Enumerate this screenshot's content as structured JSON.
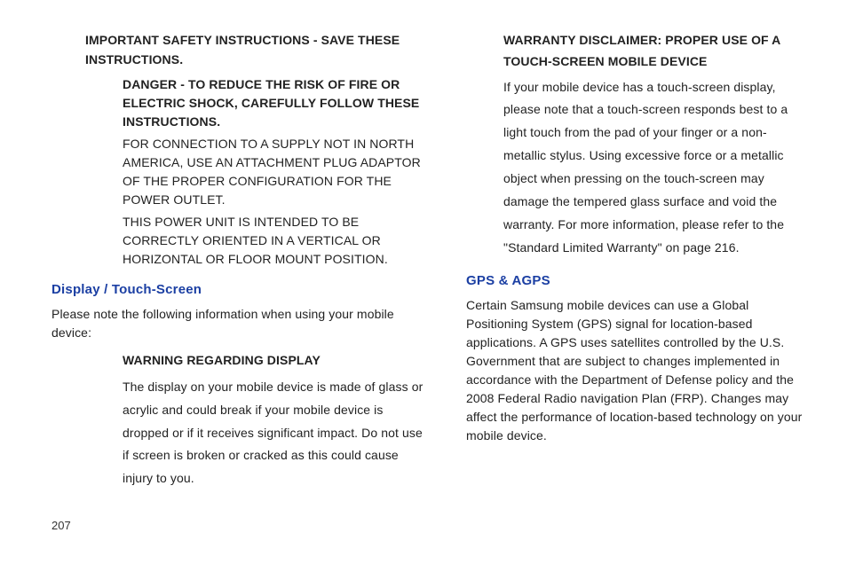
{
  "page_number": "207",
  "left": {
    "safety_heading": "IMPORTANT SAFETY INSTRUCTIONS - SAVE THESE INSTRUCTIONS.",
    "danger_bold": "DANGER - TO REDUCE THE RISK OF FIRE OR ELECTRIC SHOCK, CAREFULLY FOLLOW THESE INSTRUCTIONS.",
    "connection_text": "FOR CONNECTION TO A SUPPLY NOT IN NORTH AMERICA, USE AN ATTACHMENT PLUG ADAPTOR OF THE PROPER CONFIGURATION FOR THE POWER OUTLET.",
    "power_unit_text": "THIS POWER UNIT IS INTENDED TO BE CORRECTLY ORIENTED IN A VERTICAL OR HORIZONTAL OR FLOOR MOUNT POSITION.",
    "display_section_title": "Display / Touch-Screen",
    "display_intro": "Please note the following information when using your mobile device:",
    "warning_display_heading": "WARNING REGARDING DISPLAY",
    "warning_display_body": "The display on your mobile device is made of glass or acrylic and could break if your mobile device is dropped or if it receives significant impact. Do not use if screen is broken or cracked as this could cause injury to you."
  },
  "right": {
    "warranty_heading": "WARRANTY DISCLAIMER: PROPER USE OF A TOUCH-SCREEN MOBILE DEVICE",
    "warranty_body": "If your mobile device has a touch-screen display, please note that a touch-screen responds best to a light touch from the pad of your finger or a non-metallic stylus. Using excessive force or a metallic object when pressing on the touch-screen may damage the tempered glass surface and void the warranty.  For more information, please refer to the \"Standard Limited Warranty\" on  page 216.",
    "gps_title": "GPS & AGPS",
    "gps_body": "Certain Samsung mobile devices can use a Global Positioning System (GPS) signal for location-based applications. A GPS uses satellites controlled by the U.S. Government that are subject to changes implemented in accordance with the Department of Defense policy and the 2008 Federal Radio navigation Plan (FRP). Changes may affect the performance of location-based technology on your mobile device."
  }
}
